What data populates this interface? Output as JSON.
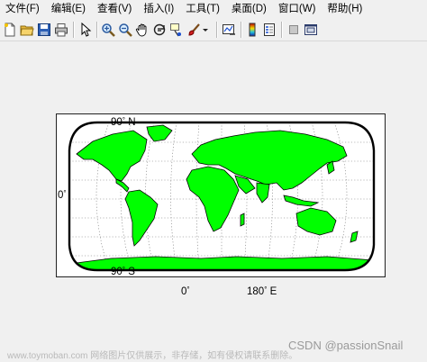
{
  "menubar": {
    "items": [
      "文件(F)",
      "编辑(E)",
      "查看(V)",
      "插入(I)",
      "工具(T)",
      "桌面(D)",
      "窗口(W)",
      "帮助(H)"
    ]
  },
  "toolbar": {
    "buttons": [
      "new-figure",
      "open-file",
      "save-figure",
      "print-figure",
      "edit-plot",
      "zoom-in",
      "zoom-out",
      "pan",
      "rotate-3d",
      "data-cursor",
      "brush",
      "brush-dropdown",
      "link-plot",
      "insert-colorbar",
      "insert-legend",
      "hide-plot-tools",
      "show-plot-tools"
    ]
  },
  "map": {
    "land_color": "#00ff00",
    "ocean_color": "#ffffff",
    "frame_color": "#000000",
    "projection_outline": "rounded",
    "grid": "dotted",
    "labels": {
      "lat_top": "90",
      "lat_top_suffix": "N",
      "lat_mid": "0",
      "lat_bottom": "90",
      "lat_bottom_suffix": "S",
      "lon_zero": "0",
      "lon_180": "180",
      "lon_180_suffix": "E"
    }
  },
  "footer": {
    "watermark": "www.toymoban.com 网络图片仅供展示，非存储，如有侵权请联系删除。",
    "csdn": "CSDN @passionSnail"
  }
}
